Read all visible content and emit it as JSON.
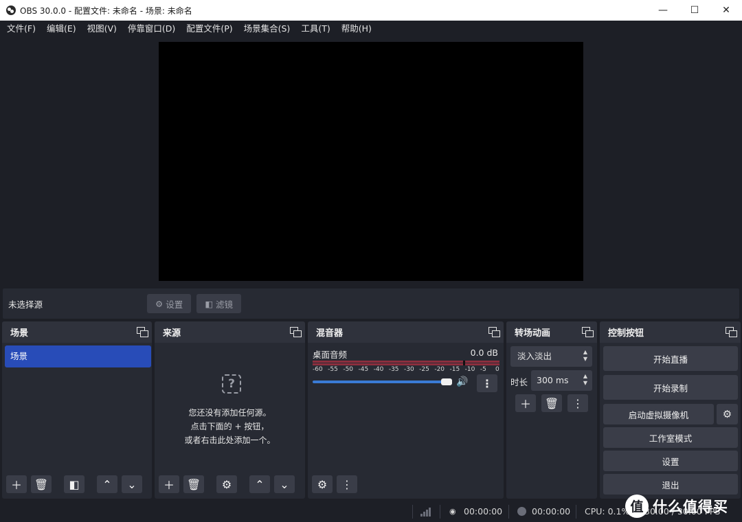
{
  "window": {
    "title": "OBS 30.0.0 - 配置文件: 未命名 - 场景: 未命名",
    "minimize": "—",
    "maximize": "☐",
    "close": "✕"
  },
  "menu": [
    "文件(F)",
    "编辑(E)",
    "视图(V)",
    "停靠窗口(D)",
    "配置文件(P)",
    "场景集合(S)",
    "工具(T)",
    "帮助(H)"
  ],
  "source_toolbar": {
    "no_source": "未选择源",
    "settings": "设置",
    "filters": "滤镜"
  },
  "scenes": {
    "title": "场景",
    "items": [
      "场景"
    ]
  },
  "sources": {
    "title": "来源",
    "empty_line1": "您还没有添加任何源。",
    "empty_line2": "点击下面的 + 按钮，",
    "empty_line3": "或者右击此处添加一个。"
  },
  "mixer": {
    "title": "混音器",
    "channel": "桌面音频",
    "level": "0.0 dB",
    "ticks": [
      "-60",
      "-55",
      "-50",
      "-45",
      "-40",
      "-35",
      "-30",
      "-25",
      "-20",
      "-15",
      "-10",
      "-5",
      "0"
    ],
    "volume_fraction": 0.97
  },
  "transitions": {
    "title": "转场动画",
    "selected": "淡入淡出",
    "duration_label": "时长",
    "duration": "300 ms"
  },
  "controls": {
    "title": "控制按钮",
    "start_stream": "开始直播",
    "start_record": "开始录制",
    "virtual_cam": "启动虚拟摄像机",
    "studio_mode": "工作室模式",
    "settings": "设置",
    "exit": "退出"
  },
  "status": {
    "stream_time": "00:00:00",
    "record_time": "00:00:00",
    "cpu": "CPU: 0.1%",
    "fps": "30.00 / 30.00 FPS"
  },
  "watermark": {
    "logo_char": "值",
    "text": "什么值得买"
  },
  "colors": {
    "accent_blue": "#284cb8",
    "meter_red": "#8c2f3e",
    "volume_blue": "#3a7bd5",
    "panel": "#272a33",
    "background": "#1d1f26"
  }
}
